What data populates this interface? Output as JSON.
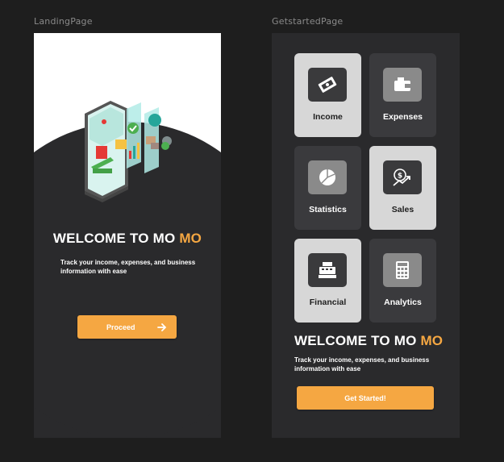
{
  "frames": {
    "landing_label": "LandingPage",
    "getstarted_label": "GetstartedPage"
  },
  "landing": {
    "welcome_prefix": "WELCOME TO MO",
    "welcome_accent": "MO",
    "subtext": "Track your income, expenses, and business information with ease",
    "proceed_label": "Proceed",
    "proceed_icon": "arrow-right-icon"
  },
  "getstarted": {
    "tiles": [
      {
        "label": "Income",
        "icon": "money-icon",
        "style": "light"
      },
      {
        "label": "Expenses",
        "icon": "wallet-icon",
        "style": "dark"
      },
      {
        "label": "Statistics",
        "icon": "pie-chart-icon",
        "style": "dark"
      },
      {
        "label": "Sales",
        "icon": "dollar-trend-icon",
        "style": "light"
      },
      {
        "label": "Financial",
        "icon": "cash-register-icon",
        "style": "light"
      },
      {
        "label": "Analytics",
        "icon": "calculator-icon",
        "style": "dark"
      }
    ],
    "welcome_prefix": "WELCOME TO MO",
    "welcome_accent": "MO",
    "subtext": "Track your income, expenses, and business information with ease",
    "cta_label": "Get Started!"
  },
  "colors": {
    "accent": "#f5a742",
    "canvas": "#1e1e1e",
    "frame_bg": "#2a2a2c",
    "tile_light": "#d7d7d7",
    "tile_dark": "#3a3a3d"
  }
}
